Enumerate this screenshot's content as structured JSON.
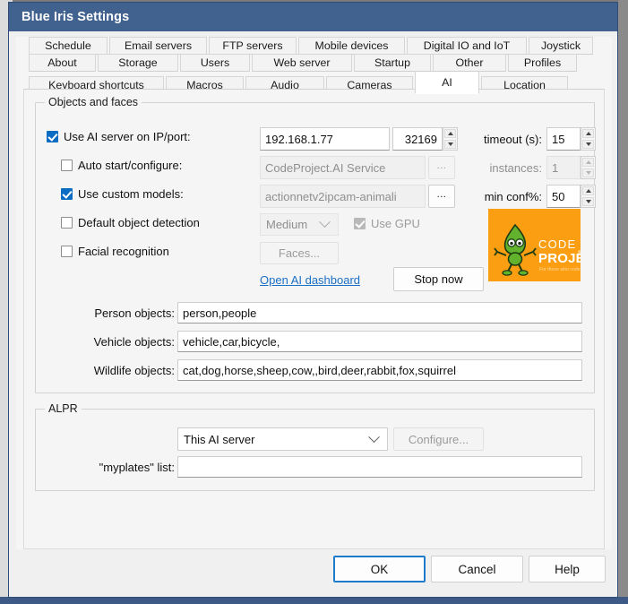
{
  "window": {
    "title": "Blue Iris Settings"
  },
  "tabs": {
    "row1": [
      {
        "label": "Schedule",
        "active": false
      },
      {
        "label": "Email servers",
        "active": false
      },
      {
        "label": "FTP servers",
        "active": false
      },
      {
        "label": "Mobile devices",
        "active": false
      },
      {
        "label": "Digital IO and IoT",
        "active": false
      },
      {
        "label": "Joystick",
        "active": false
      }
    ],
    "row2": [
      {
        "label": "About",
        "active": false
      },
      {
        "label": "Storage",
        "active": false
      },
      {
        "label": "Users",
        "active": false
      },
      {
        "label": "Web server",
        "active": false
      },
      {
        "label": "Startup",
        "active": false
      },
      {
        "label": "Other",
        "active": false
      },
      {
        "label": "Profiles",
        "active": false
      }
    ],
    "row3": [
      {
        "label": "Keyboard shortcuts",
        "active": false
      },
      {
        "label": "Macros",
        "active": false
      },
      {
        "label": "Audio",
        "active": false
      },
      {
        "label": "Cameras",
        "active": false
      },
      {
        "label": "AI",
        "active": true
      },
      {
        "label": "Location",
        "active": false
      }
    ]
  },
  "objects_group": {
    "legend": "Objects and faces",
    "use_ai_server": {
      "label": "Use AI server on IP/port:",
      "checked": true,
      "ip_value": "192.168.1.77",
      "port_value": "32169"
    },
    "auto_start": {
      "label": "Auto start/configure:",
      "checked": false,
      "service_value": "CodeProject.AI Service",
      "browse_label": "..."
    },
    "custom_models": {
      "label": "Use custom models:",
      "checked": true,
      "models_value": "actionnetv2ipcam-animali",
      "browse_label": "..."
    },
    "default_detection": {
      "label": "Default object detection",
      "checked": false,
      "size_value": "Medium"
    },
    "facial_recognition": {
      "label": "Facial recognition",
      "checked": false,
      "faces_label": "Faces..."
    },
    "use_gpu": {
      "label": "Use GPU",
      "checked": true
    },
    "timeout": {
      "label": "timeout (s):",
      "value": "15"
    },
    "instances": {
      "label": "instances:",
      "value": "1"
    },
    "min_conf": {
      "label": "min conf%:",
      "value": "50"
    },
    "dashboard_link": "Open AI dashboard",
    "stop_now_label": "Stop now",
    "logo": {
      "line1": "CODE",
      "line2": "PROJECT",
      "tagline": "For those who code",
      "background": "#fb9e11",
      "mascot_color": "#63b22e"
    },
    "person_objects": {
      "label": "Person objects:",
      "value": "person,people"
    },
    "vehicle_objects": {
      "label": "Vehicle objects:",
      "value": "vehicle,car,bicycle,"
    },
    "wildlife_objects": {
      "label": "Wildlife objects:",
      "value": "cat,dog,horse,sheep,cow,,bird,deer,rabbit,fox,squirrel"
    }
  },
  "alpr_group": {
    "legend": "ALPR",
    "server_value": "This AI server",
    "configure_label": "Configure...",
    "myplates": {
      "label": "\"myplates\" list:",
      "value": ""
    }
  },
  "footer": {
    "ok_label": "OK",
    "cancel_label": "Cancel",
    "help_label": "Help"
  },
  "colors": {
    "titlebar": "#41618f",
    "accent_checkbox": "#0b6cc4",
    "link": "#1a6fc4",
    "logo_orange": "#fb9e11"
  }
}
